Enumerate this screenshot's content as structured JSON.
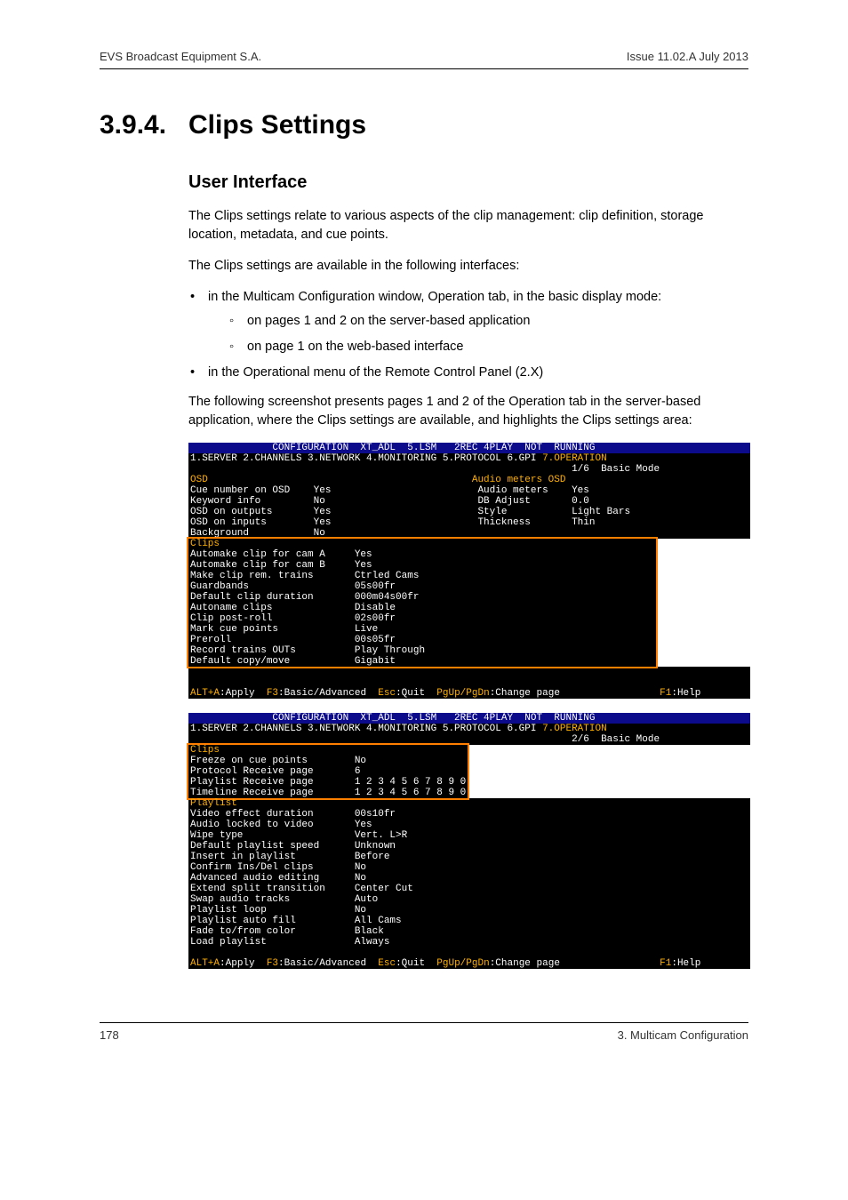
{
  "header": {
    "left": "EVS Broadcast Equipment S.A.",
    "right": "Issue 11.02.A  July 2013"
  },
  "heading": {
    "num": "3.9.4.",
    "title": "Clips Settings"
  },
  "subheading": "User Interface",
  "para1": "The Clips settings relate to various aspects of the clip management: clip definition, storage location, metadata, and cue points.",
  "para2": "The Clips settings are available in the following interfaces:",
  "bullets": {
    "b1": "in the Multicam Configuration window, Operation tab, in the basic display mode:",
    "b1a": "on pages 1 and 2 on the server-based application",
    "b1b": "on page 1 on the web-based interface",
    "b2": "in the Operational menu of the Remote Control Panel (2.X)"
  },
  "para3": "The following screenshot presents pages 1 and 2 of the Operation tab in the server-based application, where the Clips settings are available, and highlights the Clips settings area:",
  "screen1": {
    "titlebar": "              CONFIGURATION  XT_ADL  5.LSM   2REC 4PLAY  NOT  RUNNING           ",
    "tabs": "1.SERVER 2.CHANNELS 3.NETWORK 4.MONITORING 5.PROTOCOL 6.GPI ",
    "tabs_hi": "7.OPERATION",
    "mode": "                                                                 1/6  Basic Mode",
    "osd_head": "OSD                                             Audio meters OSD              ",
    "osd_l1": "Cue number on OSD    Yes                         Audio meters    Yes            ",
    "osd_l2": "Keyword info         No                          DB Adjust       0.0            ",
    "osd_l3": "OSD on outputs       Yes                         Style           Light Bars     ",
    "osd_l4": "OSD on inputs        Yes                         Thickness       Thin           ",
    "osd_l5": "Background           No                                                         ",
    "clips_head": "Clips                                                                          ",
    "c1": "Automake clip for cam A     Yes              ",
    "c2": "Automake clip for cam B     Yes              ",
    "c3": "Make clip rem. trains       Ctrled Cams      ",
    "c4": "Guardbands                  05s00fr          ",
    "c5": "Default clip duration       000m04s00fr      ",
    "c6": "Autoname clips              Disable          ",
    "c7": "Clip post-roll              02s00fr          ",
    "c8": "Mark cue points             Live             ",
    "c9": "Preroll                     00s05fr          ",
    "c10": "Record trains OUTs          Play Through     ",
    "c11": "Default copy/move           Gigabit          ",
    "footer_a": "ALT+A",
    "footer_b": ":Apply  ",
    "footer_c": "F3",
    "footer_d": ":Basic/Advanced  ",
    "footer_e": "Esc",
    "footer_f": ":Quit  ",
    "footer_g": "PgUp/PgDn",
    "footer_h": ":Change page                 ",
    "footer_i": "F1",
    "footer_j": ":Help"
  },
  "screen2": {
    "titlebar": "              CONFIGURATION  XT_ADL  5.LSM   2REC 4PLAY  NOT  RUNNING           ",
    "tabs": "1.SERVER 2.CHANNELS 3.NETWORK 4.MONITORING 5.PROTOCOL 6.GPI ",
    "tabs_hi": "7.OPERATION",
    "mode": "                                                                 2/6  Basic Mode",
    "clips_head": "Clips                                        ",
    "c1": "Freeze on cue points        No               ",
    "c2": "Protocol Receive page       6                ",
    "c3": "Playlist Receive page       1 2 3 4 5 6 7 8 9 0",
    "c4": "Timeline Receive page       1 2 3 4 5 6 7 8 9 0",
    "pl_head": "Playlist                                                                       ",
    "p1": "Video effect duration       00s10fr                                            ",
    "p2": "Audio locked to video       Yes                                                ",
    "p3": "Wipe type                   Vert. L>R                                          ",
    "p4": "Default playlist speed      Unknown                                            ",
    "p5": "Insert in playlist          Before                                             ",
    "p6": "Confirm Ins/Del clips       No                                                 ",
    "p7": "Advanced audio editing      No                                                 ",
    "p8": "Extend split transition     Center Cut                                         ",
    "p9": "Swap audio tracks           Auto                                               ",
    "p10": "Playlist loop               No                                                 ",
    "p11": "Playlist auto fill          All Cams                                           ",
    "p12": "Fade to/from color          Black                                              ",
    "p13": "Load playlist               Always                                             ",
    "footer_a": "ALT+A",
    "footer_b": ":Apply  ",
    "footer_c": "F3",
    "footer_d": ":Basic/Advanced  ",
    "footer_e": "Esc",
    "footer_f": ":Quit  ",
    "footer_g": "PgUp/PgDn",
    "footer_h": ":Change page                 ",
    "footer_i": "F1",
    "footer_j": ":Help"
  },
  "footer": {
    "left": "178",
    "right": "3. Multicam Configuration"
  }
}
